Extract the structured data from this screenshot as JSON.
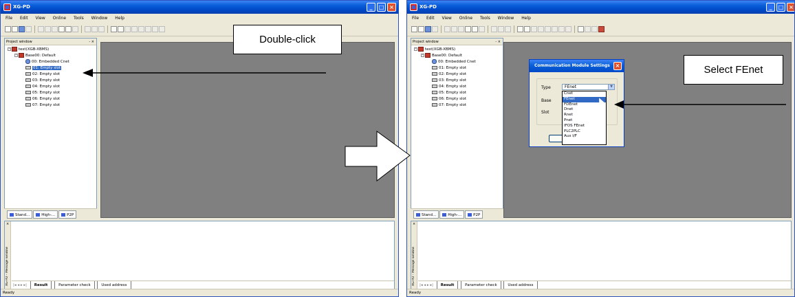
{
  "left": {
    "app_title": "XG-PD",
    "menu": [
      "File",
      "Edit",
      "View",
      "Online",
      "Tools",
      "Window",
      "Help"
    ],
    "project_window": {
      "title": "Project window",
      "root": "test(XGB-XBMS)",
      "base": "Base00: Default",
      "slots": [
        "00: Embedded Cnet",
        "01: Empty slot",
        "02: Empty slot",
        "03: Empty slot",
        "04: Empty slot",
        "05: Empty slot",
        "06: Empty slot",
        "07: Empty slot"
      ],
      "tabs": [
        "Stand...",
        "High-...",
        "P2P"
      ]
    },
    "message_window": {
      "label": "XG-PD - Message window",
      "tabs": [
        "Result",
        "Parameter check",
        "Used address"
      ]
    },
    "status": "Ready",
    "callout": "Double-click"
  },
  "right": {
    "app_title": "XG-PD",
    "menu": [
      "File",
      "Edit",
      "View",
      "Online",
      "Tools",
      "Window",
      "Help"
    ],
    "project_window": {
      "title": "Project window",
      "root": "test(XGB-XBMS)",
      "base": "Base00: Default",
      "slots": [
        "00: Embedded Cnet",
        "01: Empty slot",
        "02: Empty slot",
        "03: Empty slot",
        "04: Empty slot",
        "05: Empty slot",
        "06: Empty slot",
        "07: Empty slot"
      ],
      "tabs": [
        "Stand...",
        "High-...",
        "P2P"
      ]
    },
    "dialog": {
      "title": "Communication Module Settings",
      "type_label": "Type",
      "type_value": "FEnet",
      "base_label": "Base",
      "slot_label": "Slot",
      "options": [
        "Cnet",
        "FEnet",
        "FDEnet",
        "Dnet",
        "Rnet",
        "Pnet",
        "IFOS FEnet",
        "PLC2PLC",
        "Aux I/F"
      ],
      "selected_option": "FEnet"
    },
    "message_window": {
      "label": "XG-PD - Message window",
      "tabs": [
        "Result",
        "Parameter check",
        "Used address"
      ]
    },
    "status": "Ready",
    "callout": "Select FEnet"
  },
  "colors": {
    "title_blue": "#0a5fd8",
    "selection": "#316ac5",
    "mdi_gray": "#808080"
  }
}
